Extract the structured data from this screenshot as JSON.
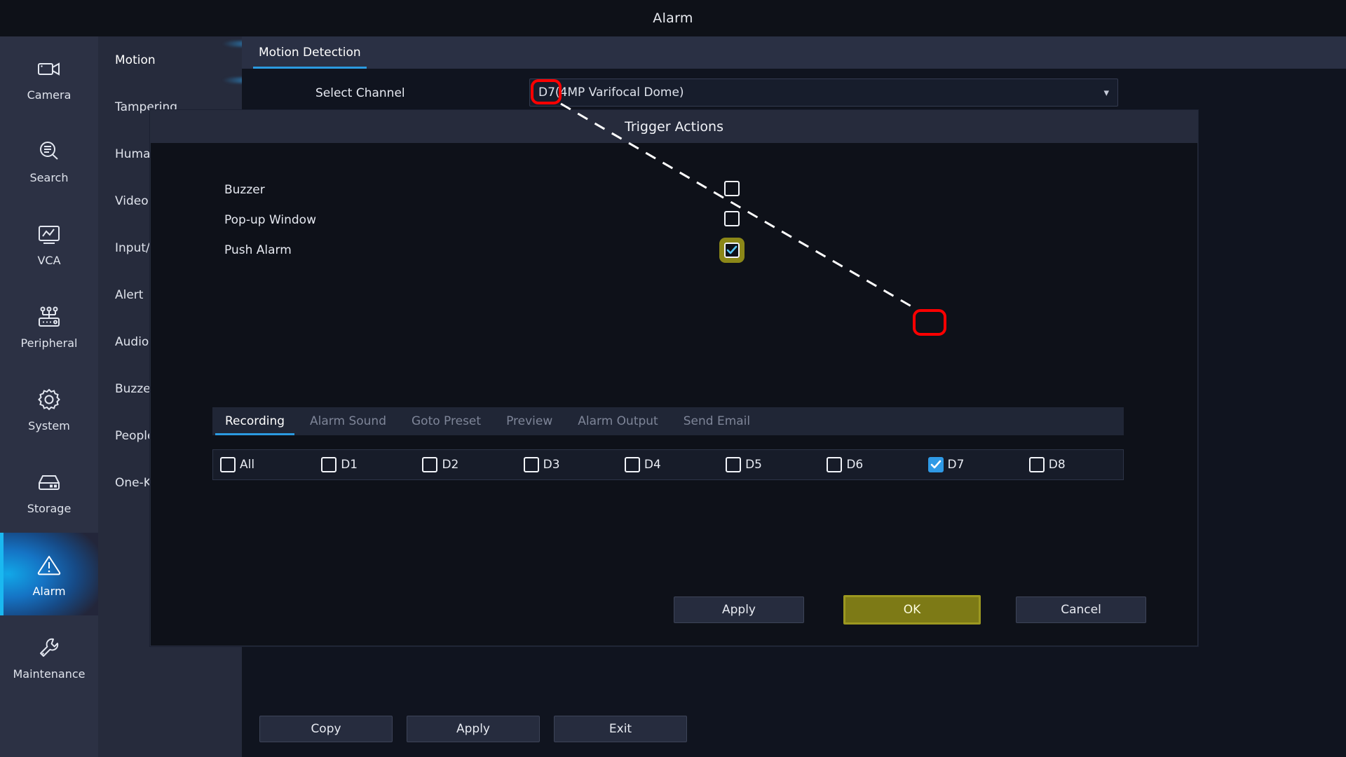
{
  "window": {
    "title": "Alarm"
  },
  "rail": {
    "items": [
      {
        "label": "Camera",
        "icon": "camera-icon",
        "active": false
      },
      {
        "label": "Search",
        "icon": "search-icon",
        "active": false
      },
      {
        "label": "VCA",
        "icon": "vca-icon",
        "active": false
      },
      {
        "label": "Peripheral",
        "icon": "peripheral-icon",
        "active": false
      },
      {
        "label": "System",
        "icon": "gear-icon",
        "active": false
      },
      {
        "label": "Storage",
        "icon": "storage-icon",
        "active": false
      },
      {
        "label": "Alarm",
        "icon": "alarm-warning-icon",
        "active": true
      },
      {
        "label": "Maintenance",
        "icon": "wrench-icon",
        "active": false
      }
    ]
  },
  "submenu": {
    "items": [
      {
        "label": "Motion",
        "active": true
      },
      {
        "label": "Tampering",
        "active": false
      },
      {
        "label": "Human Body Detection",
        "active": false
      },
      {
        "label": "Video Loss",
        "active": false
      },
      {
        "label": "Input/Output",
        "active": false
      },
      {
        "label": "Alert",
        "active": false
      },
      {
        "label": "Audio Detection",
        "active": false
      },
      {
        "label": "Buzzer",
        "active": false
      },
      {
        "label": "People Counting",
        "active": false
      },
      {
        "label": "One-Key Disarming",
        "active": false
      }
    ]
  },
  "main": {
    "tabs": [
      {
        "label": "Motion Detection",
        "active": true
      }
    ],
    "select_channel_label": "Select Channel",
    "select_channel_value": "D7(4MP Varifocal Dome)",
    "caret_icon": "chevron-down-icon",
    "bottom_buttons": [
      "Copy",
      "Apply",
      "Exit"
    ]
  },
  "dialog": {
    "title": "Trigger Actions",
    "actions": [
      {
        "label": "Buzzer",
        "checked": false,
        "focused": false
      },
      {
        "label": "Pop-up Window",
        "checked": false,
        "focused": false
      },
      {
        "label": "Push Alarm",
        "checked": true,
        "focused": true
      }
    ],
    "tabs": [
      {
        "label": "Recording",
        "active": true
      },
      {
        "label": "Alarm Sound",
        "active": false
      },
      {
        "label": "Goto Preset",
        "active": false
      },
      {
        "label": "Preview",
        "active": false
      },
      {
        "label": "Alarm Output",
        "active": false
      },
      {
        "label": "Send Email",
        "active": false
      }
    ],
    "channels": [
      {
        "label": "All",
        "checked": false
      },
      {
        "label": "D1",
        "checked": false
      },
      {
        "label": "D2",
        "checked": false
      },
      {
        "label": "D3",
        "checked": false
      },
      {
        "label": "D4",
        "checked": false
      },
      {
        "label": "D5",
        "checked": false
      },
      {
        "label": "D6",
        "checked": false
      },
      {
        "label": "D7",
        "checked": true
      },
      {
        "label": "D8",
        "checked": false
      }
    ],
    "buttons": {
      "apply": "Apply",
      "ok": "OK",
      "cancel": "Cancel"
    }
  },
  "annotations": {
    "highlight_color": "#ff0000",
    "callout_from": "D7 in Select Channel",
    "callout_to": "D7 channel checkbox"
  },
  "colors": {
    "accent_blue": "#2b9ae0",
    "focus_olive": "#8b8718",
    "annotation_red": "#ff0000",
    "rail_bg": "#2c3144",
    "content_bg": "#10141f"
  }
}
